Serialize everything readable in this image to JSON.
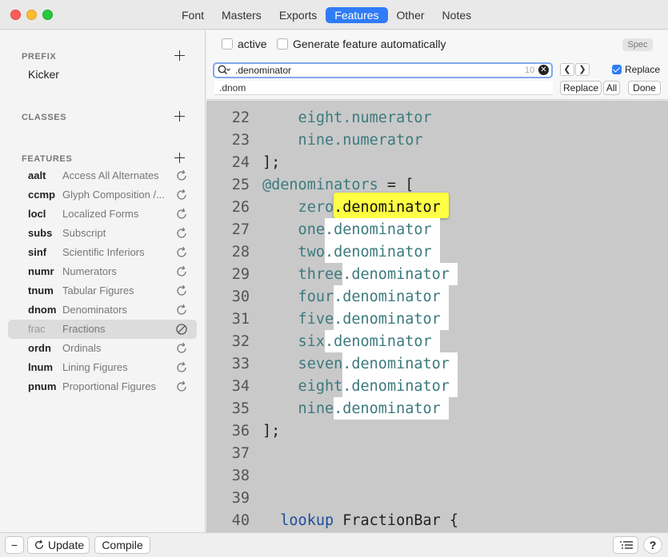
{
  "tabs": [
    "Font",
    "Masters",
    "Exports",
    "Features",
    "Other",
    "Notes"
  ],
  "active_tab": "Features",
  "sidebar": {
    "prefix_header": "PREFIX",
    "prefix_item": "Kicker",
    "classes_header": "CLASSES",
    "features_header": "FEATURES",
    "features": [
      {
        "tag": "aalt",
        "name": "Access All Alternates",
        "icon": "refresh-icon"
      },
      {
        "tag": "ccmp",
        "name": "Glyph Composition /...",
        "icon": "refresh-icon"
      },
      {
        "tag": "locl",
        "name": "Localized Forms",
        "icon": "refresh-icon"
      },
      {
        "tag": "subs",
        "name": "Subscript",
        "icon": "refresh-icon"
      },
      {
        "tag": "sinf",
        "name": "Scientific Inferiors",
        "icon": "refresh-icon"
      },
      {
        "tag": "numr",
        "name": "Numerators",
        "icon": "refresh-icon"
      },
      {
        "tag": "tnum",
        "name": "Tabular Figures",
        "icon": "refresh-icon"
      },
      {
        "tag": "dnom",
        "name": "Denominators",
        "icon": "refresh-icon"
      },
      {
        "tag": "frac",
        "name": "Fractions",
        "icon": "disabled-icon"
      },
      {
        "tag": "ordn",
        "name": "Ordinals",
        "icon": "refresh-icon"
      },
      {
        "tag": "lnum",
        "name": "Lining Figures",
        "icon": "refresh-icon"
      },
      {
        "tag": "pnum",
        "name": "Proportional Figures",
        "icon": "refresh-icon"
      }
    ],
    "selected_feature": "frac"
  },
  "topbar": {
    "active_label": "active",
    "generate_label": "Generate feature automatically",
    "spec_label": "Spec",
    "search_value": ".denominator",
    "match_count": "10",
    "replace_check_label": "Replace",
    "replace_value": ".dnom",
    "replace_button": "Replace",
    "all_button": "All",
    "done_button": "Done"
  },
  "code": {
    "lines": [
      {
        "num": "22",
        "pre": "    eight",
        "match": "",
        "post": ".numerator",
        "style": "teal"
      },
      {
        "num": "23",
        "pre": "    nine",
        "match": "",
        "post": ".numerator",
        "style": "teal"
      },
      {
        "num": "24",
        "pre": "];",
        "match": "",
        "post": "",
        "style": "plain"
      },
      {
        "num": "25",
        "pre": "@denominators",
        "match": "",
        "post": " = [",
        "style": "classdef"
      },
      {
        "num": "26",
        "pre": "    zero",
        "match": ".denominator",
        "post": "",
        "style": "current"
      },
      {
        "num": "27",
        "pre": "    one",
        "match": ".denominator",
        "post": "",
        "style": "match"
      },
      {
        "num": "28",
        "pre": "    two",
        "match": ".denominator",
        "post": "",
        "style": "match"
      },
      {
        "num": "29",
        "pre": "    three",
        "match": ".denominator",
        "post": "",
        "style": "match"
      },
      {
        "num": "30",
        "pre": "    four",
        "match": ".denominator",
        "post": "",
        "style": "match"
      },
      {
        "num": "31",
        "pre": "    five",
        "match": ".denominator",
        "post": "",
        "style": "match"
      },
      {
        "num": "32",
        "pre": "    six",
        "match": ".denominator",
        "post": "",
        "style": "match"
      },
      {
        "num": "33",
        "pre": "    seven",
        "match": ".denominator",
        "post": "",
        "style": "match"
      },
      {
        "num": "34",
        "pre": "    eight",
        "match": ".denominator",
        "post": "",
        "style": "match"
      },
      {
        "num": "35",
        "pre": "    nine",
        "match": ".denominator",
        "post": "",
        "style": "match"
      },
      {
        "num": "36",
        "pre": "];",
        "match": "",
        "post": "",
        "style": "plain"
      },
      {
        "num": "37",
        "pre": "",
        "match": "",
        "post": "",
        "style": "plain"
      },
      {
        "num": "38",
        "pre": "",
        "match": "",
        "post": "",
        "style": "plain"
      },
      {
        "num": "39",
        "pre": "",
        "match": "",
        "post": "",
        "style": "plain"
      },
      {
        "num": "40",
        "pre": "  lookup",
        "match": "",
        "post": " FractionBar {",
        "style": "lookup"
      }
    ]
  },
  "bottombar": {
    "remove_label": "−",
    "update_label": "Update",
    "compile_label": "Compile",
    "help_label": "?"
  }
}
